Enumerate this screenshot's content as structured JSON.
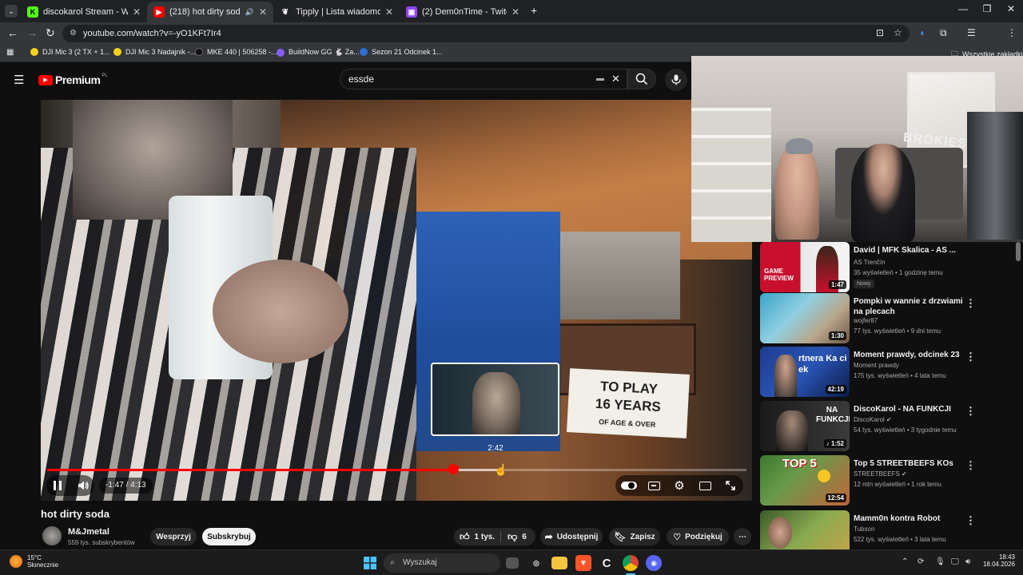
{
  "browser": {
    "tabs": [
      {
        "title": "discokarol Stream - Watch Live",
        "icon": "kick-icon",
        "active": false
      },
      {
        "title": "(218) hot dirty soda - YouTube",
        "icon": "youtube-icon",
        "active": true
      },
      {
        "title": "Tipply | Lista wiadomości",
        "icon": "tipply-icon",
        "active": false
      },
      {
        "title": "(2) Dem0nTime - Twitch",
        "icon": "twitch-icon",
        "active": false
      }
    ],
    "url": "youtube.com/watch?v=-yO1KFt7Ir4",
    "bookmarks": [
      {
        "label": "DJI Mic 3 (2 TX + 1...",
        "color": "#f4d21f"
      },
      {
        "label": "DJI Mic 3 Nadajnik -...",
        "color": "#f4d21f"
      },
      {
        "label": "MKE 440 | 506258 -...",
        "color": "#111111"
      },
      {
        "label": "BuildNow GG 🐇 Za...",
        "color": "#8a5cf6"
      },
      {
        "label": "Sezon 21 Odcinek 1...",
        "color": "#2c6fd6"
      }
    ],
    "all_bookmarks": "Wszystkie zakładki"
  },
  "youtube": {
    "logo": "Premium",
    "logo_region": "PL",
    "search_value": "essde",
    "video": {
      "title": "hot dirty soda",
      "time_display": "-1:47 / 4:13",
      "progress": 0.58,
      "hover_progress": 0.643,
      "preview_time": "2:42",
      "sign_text_line1": "TO PLAY",
      "sign_text_line2": "16 YEARS",
      "sign_text_line3": "OF AGE & OVER"
    },
    "channel": {
      "name": "M&Jmetal",
      "subscribers": "559 tys. subskrybentów",
      "support_label": "Wesprzyj",
      "subscribe_label": "Subskrybuj"
    },
    "actions": {
      "likes": "1 tys.",
      "dislikes": "6",
      "share": "Udostępnij",
      "save": "Zapisz",
      "thanks": "Podziękuj"
    },
    "overlay_text": "BROKIES",
    "recommendations": [
      {
        "title": "David | MFK Skalica - AS ...",
        "channel": "AS Trenčín",
        "meta": "35 wyświetleń • 1 godzinę temu",
        "duration": "1:47",
        "badge": "Nowy",
        "verified": false,
        "thumb_label": "GAME PREVIEW",
        "colors": [
          "#c8102e",
          "#e9e9e9"
        ]
      },
      {
        "title": "Pompki w wannie z drzwiami na plecach",
        "channel": "wojfer87",
        "meta": "77 tys. wyświetleń • 9 dni temu",
        "duration": "1:30",
        "badge": "",
        "verified": false,
        "thumb_label": "",
        "colors": [
          "#3aa3c8",
          "#b8a58a"
        ]
      },
      {
        "title": "Moment prawdy, odcinek 23",
        "channel": "Moment prawdy",
        "meta": "175 tys. wyświetleń • 4 lata temu",
        "duration": "42:19",
        "badge": "",
        "verified": false,
        "thumb_label": "rtnera Ka ci ek",
        "colors": [
          "#1d3c8f",
          "#0c1c4a"
        ]
      },
      {
        "title": "DiscoKarol - NA FUNKCJI",
        "channel": "DiscoKarol",
        "meta": "54 tys. wyświetleń • 3 tygodnie temu",
        "duration": "♪ 1:52",
        "badge": "",
        "verified": true,
        "thumb_label": "NA FUNKCJI",
        "colors": [
          "#1a1a1a",
          "#3a3a3a"
        ]
      },
      {
        "title": "Top 5 STREETBEEFS KOs",
        "channel": "STREETBEEFS",
        "meta": "12 mln wyświetleń • 1 rok temu",
        "duration": "12:54",
        "badge": "",
        "verified": true,
        "thumb_label": "TOP 5",
        "colors": [
          "#3d7a2f",
          "#c0633a"
        ]
      },
      {
        "title": "Mamm0n kontra Robot",
        "channel": "Tubson",
        "meta": "522 tys. wyświetleń • 3 lata temu",
        "duration": "",
        "badge": "",
        "verified": false,
        "thumb_label": "",
        "colors": [
          "#3a5b2a",
          "#8aa94f"
        ]
      }
    ]
  },
  "taskbar": {
    "weather_temp": "15°C",
    "weather_desc": "Słonecznie",
    "search_placeholder": "Wyszukaj",
    "time": "18:43",
    "date": "18.04.2026"
  }
}
